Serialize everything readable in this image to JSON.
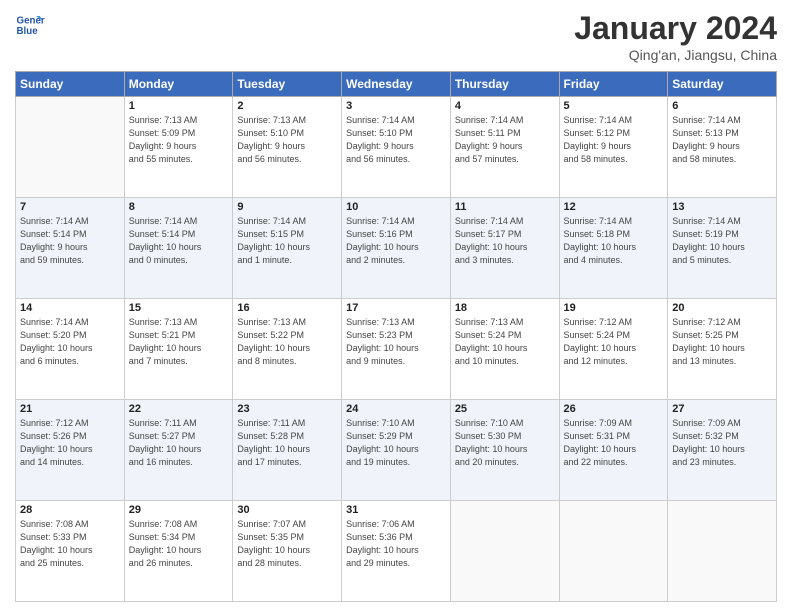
{
  "header": {
    "logo_line1": "General",
    "logo_line2": "Blue",
    "month_year": "January 2024",
    "location": "Qing'an, Jiangsu, China"
  },
  "weekdays": [
    "Sunday",
    "Monday",
    "Tuesday",
    "Wednesday",
    "Thursday",
    "Friday",
    "Saturday"
  ],
  "weeks": [
    [
      {
        "day": "",
        "info": ""
      },
      {
        "day": "1",
        "info": "Sunrise: 7:13 AM\nSunset: 5:09 PM\nDaylight: 9 hours\nand 55 minutes."
      },
      {
        "day": "2",
        "info": "Sunrise: 7:13 AM\nSunset: 5:10 PM\nDaylight: 9 hours\nand 56 minutes."
      },
      {
        "day": "3",
        "info": "Sunrise: 7:14 AM\nSunset: 5:10 PM\nDaylight: 9 hours\nand 56 minutes."
      },
      {
        "day": "4",
        "info": "Sunrise: 7:14 AM\nSunset: 5:11 PM\nDaylight: 9 hours\nand 57 minutes."
      },
      {
        "day": "5",
        "info": "Sunrise: 7:14 AM\nSunset: 5:12 PM\nDaylight: 9 hours\nand 58 minutes."
      },
      {
        "day": "6",
        "info": "Sunrise: 7:14 AM\nSunset: 5:13 PM\nDaylight: 9 hours\nand 58 minutes."
      }
    ],
    [
      {
        "day": "7",
        "info": "Sunrise: 7:14 AM\nSunset: 5:14 PM\nDaylight: 9 hours\nand 59 minutes."
      },
      {
        "day": "8",
        "info": "Sunrise: 7:14 AM\nSunset: 5:14 PM\nDaylight: 10 hours\nand 0 minutes."
      },
      {
        "day": "9",
        "info": "Sunrise: 7:14 AM\nSunset: 5:15 PM\nDaylight: 10 hours\nand 1 minute."
      },
      {
        "day": "10",
        "info": "Sunrise: 7:14 AM\nSunset: 5:16 PM\nDaylight: 10 hours\nand 2 minutes."
      },
      {
        "day": "11",
        "info": "Sunrise: 7:14 AM\nSunset: 5:17 PM\nDaylight: 10 hours\nand 3 minutes."
      },
      {
        "day": "12",
        "info": "Sunrise: 7:14 AM\nSunset: 5:18 PM\nDaylight: 10 hours\nand 4 minutes."
      },
      {
        "day": "13",
        "info": "Sunrise: 7:14 AM\nSunset: 5:19 PM\nDaylight: 10 hours\nand 5 minutes."
      }
    ],
    [
      {
        "day": "14",
        "info": "Sunrise: 7:14 AM\nSunset: 5:20 PM\nDaylight: 10 hours\nand 6 minutes."
      },
      {
        "day": "15",
        "info": "Sunrise: 7:13 AM\nSunset: 5:21 PM\nDaylight: 10 hours\nand 7 minutes."
      },
      {
        "day": "16",
        "info": "Sunrise: 7:13 AM\nSunset: 5:22 PM\nDaylight: 10 hours\nand 8 minutes."
      },
      {
        "day": "17",
        "info": "Sunrise: 7:13 AM\nSunset: 5:23 PM\nDaylight: 10 hours\nand 9 minutes."
      },
      {
        "day": "18",
        "info": "Sunrise: 7:13 AM\nSunset: 5:24 PM\nDaylight: 10 hours\nand 10 minutes."
      },
      {
        "day": "19",
        "info": "Sunrise: 7:12 AM\nSunset: 5:24 PM\nDaylight: 10 hours\nand 12 minutes."
      },
      {
        "day": "20",
        "info": "Sunrise: 7:12 AM\nSunset: 5:25 PM\nDaylight: 10 hours\nand 13 minutes."
      }
    ],
    [
      {
        "day": "21",
        "info": "Sunrise: 7:12 AM\nSunset: 5:26 PM\nDaylight: 10 hours\nand 14 minutes."
      },
      {
        "day": "22",
        "info": "Sunrise: 7:11 AM\nSunset: 5:27 PM\nDaylight: 10 hours\nand 16 minutes."
      },
      {
        "day": "23",
        "info": "Sunrise: 7:11 AM\nSunset: 5:28 PM\nDaylight: 10 hours\nand 17 minutes."
      },
      {
        "day": "24",
        "info": "Sunrise: 7:10 AM\nSunset: 5:29 PM\nDaylight: 10 hours\nand 19 minutes."
      },
      {
        "day": "25",
        "info": "Sunrise: 7:10 AM\nSunset: 5:30 PM\nDaylight: 10 hours\nand 20 minutes."
      },
      {
        "day": "26",
        "info": "Sunrise: 7:09 AM\nSunset: 5:31 PM\nDaylight: 10 hours\nand 22 minutes."
      },
      {
        "day": "27",
        "info": "Sunrise: 7:09 AM\nSunset: 5:32 PM\nDaylight: 10 hours\nand 23 minutes."
      }
    ],
    [
      {
        "day": "28",
        "info": "Sunrise: 7:08 AM\nSunset: 5:33 PM\nDaylight: 10 hours\nand 25 minutes."
      },
      {
        "day": "29",
        "info": "Sunrise: 7:08 AM\nSunset: 5:34 PM\nDaylight: 10 hours\nand 26 minutes."
      },
      {
        "day": "30",
        "info": "Sunrise: 7:07 AM\nSunset: 5:35 PM\nDaylight: 10 hours\nand 28 minutes."
      },
      {
        "day": "31",
        "info": "Sunrise: 7:06 AM\nSunset: 5:36 PM\nDaylight: 10 hours\nand 29 minutes."
      },
      {
        "day": "",
        "info": ""
      },
      {
        "day": "",
        "info": ""
      },
      {
        "day": "",
        "info": ""
      }
    ]
  ]
}
